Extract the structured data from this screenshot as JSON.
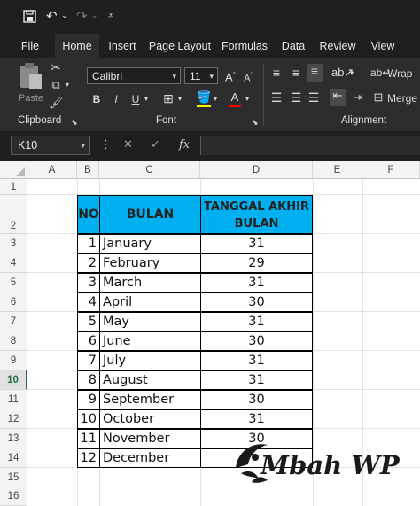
{
  "qat": {
    "icons": [
      "save-icon",
      "undo-icon",
      "redo-icon",
      "customize-qat-icon"
    ]
  },
  "tabs": [
    {
      "label": "File"
    },
    {
      "label": "Home"
    },
    {
      "label": "Insert"
    },
    {
      "label": "Page Layout"
    },
    {
      "label": "Formulas"
    },
    {
      "label": "Data"
    },
    {
      "label": "Review"
    },
    {
      "label": "View"
    }
  ],
  "ribbon": {
    "clipboard": {
      "label": "Clipboard",
      "paste_label": "Paste"
    },
    "font": {
      "label": "Font",
      "name": "Calibri",
      "size": "11",
      "bold": "B",
      "italic": "I",
      "underline": "U"
    },
    "alignment": {
      "label": "Alignment",
      "wrap": "Wrap",
      "merge": "Merge"
    }
  },
  "formula_bar": {
    "name_box": "K10",
    "fx_label": "fx",
    "value": ""
  },
  "grid": {
    "columns": [
      "A",
      "B",
      "C",
      "D",
      "E",
      "F"
    ],
    "rows": [
      "1",
      "2",
      "3",
      "4",
      "5",
      "6",
      "7",
      "8",
      "9",
      "10",
      "11",
      "12",
      "13",
      "14",
      "15",
      "16"
    ],
    "selected_row": "10"
  },
  "table": {
    "headers": {
      "no": "NO",
      "bulan": "BULAN",
      "tanggal_line1": "TANGGAL AKHIR",
      "tanggal_line2": "BULAN"
    },
    "rows": [
      {
        "no": "1",
        "month": "January",
        "day": "31"
      },
      {
        "no": "2",
        "month": "February",
        "day": "29"
      },
      {
        "no": "3",
        "month": "March",
        "day": "31"
      },
      {
        "no": "4",
        "month": "April",
        "day": "30"
      },
      {
        "no": "5",
        "month": "May",
        "day": "31"
      },
      {
        "no": "6",
        "month": "June",
        "day": "30"
      },
      {
        "no": "7",
        "month": "July",
        "day": "31"
      },
      {
        "no": "8",
        "month": "August",
        "day": "31"
      },
      {
        "no": "9",
        "month": "September",
        "day": "30"
      },
      {
        "no": "10",
        "month": "October",
        "day": "31"
      },
      {
        "no": "11",
        "month": "November",
        "day": "30"
      },
      {
        "no": "12",
        "month": "December",
        "day": ""
      }
    ],
    "header_color": "#00b0f0"
  },
  "watermark": {
    "text": "Mbah WP"
  },
  "colors": {
    "ribbon_bg": "#2d2d2d",
    "title_bg": "#1f1f1f",
    "accent": "#217346"
  }
}
